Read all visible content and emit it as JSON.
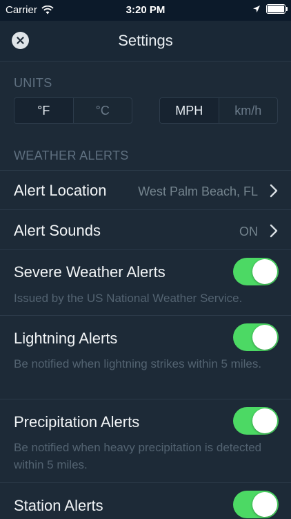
{
  "status_bar": {
    "carrier": "Carrier",
    "time": "3:20 PM"
  },
  "nav": {
    "title": "Settings"
  },
  "units": {
    "label": "UNITS",
    "temperature": {
      "options": [
        "°F",
        "°C"
      ],
      "selected": "°F"
    },
    "speed": {
      "options": [
        "MPH",
        "km/h"
      ],
      "selected": "MPH"
    }
  },
  "weather_alerts": {
    "label": "WEATHER ALERTS",
    "alert_location": {
      "title": "Alert Location",
      "value": "West Palm Beach, FL"
    },
    "alert_sounds": {
      "title": "Alert Sounds",
      "value": "ON"
    },
    "severe": {
      "title": "Severe Weather Alerts",
      "subtitle": "Issued by the US National Weather Service.",
      "enabled": true
    },
    "lightning": {
      "title": "Lightning Alerts",
      "subtitle": "Be notified when lightning strikes within 5 miles.",
      "enabled": true
    },
    "precipitation": {
      "title": "Precipitation Alerts",
      "subtitle": "Be notified when heavy precipitation is detected within 5 miles.",
      "enabled": true
    },
    "station": {
      "title": "Station Alerts",
      "enabled": true
    }
  },
  "colors": {
    "toggle_on": "#4cd964",
    "background": "#1d2a37",
    "status_bar": "#0c1a2a"
  }
}
